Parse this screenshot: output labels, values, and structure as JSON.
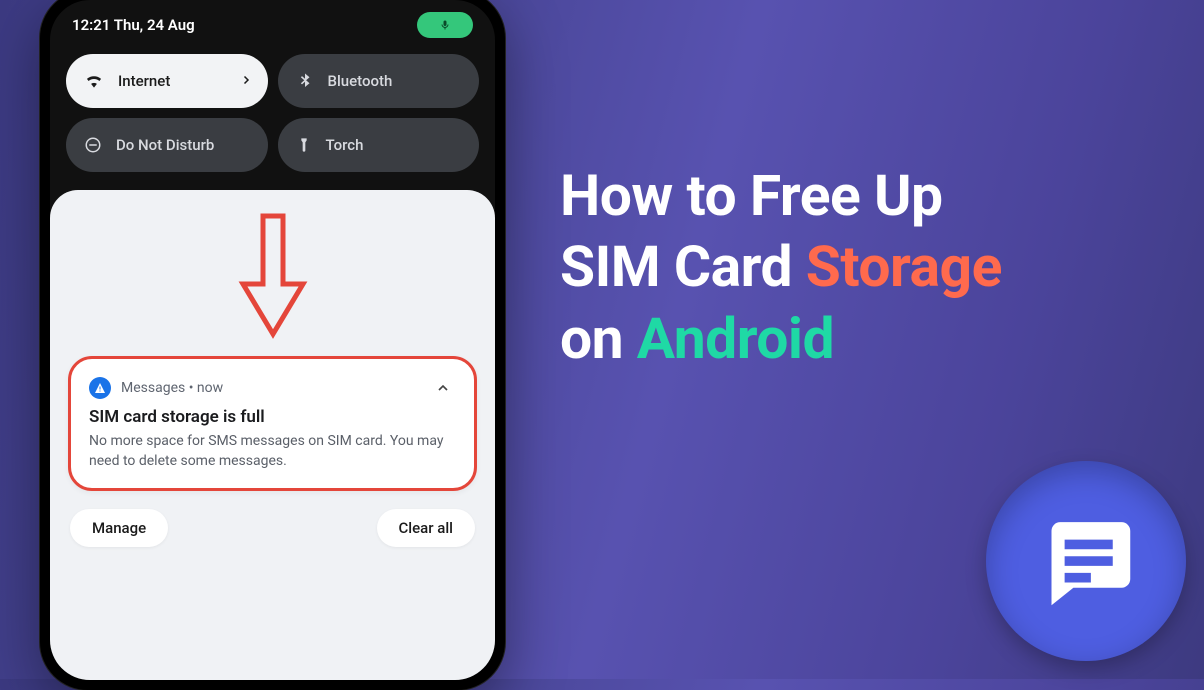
{
  "status": {
    "time_date": "12:21 Thu, 24 Aug"
  },
  "qs": {
    "internet": {
      "label": "Internet"
    },
    "bluetooth": {
      "label": "Bluetooth"
    },
    "dnd": {
      "label": "Do Not Disturb"
    },
    "torch": {
      "label": "Torch"
    }
  },
  "notification": {
    "app": "Messages",
    "sep": " • ",
    "when": "now",
    "title": "SIM card storage is full",
    "body": "No more space for SMS messages on SIM card. You may need to delete some messages."
  },
  "shade_actions": {
    "manage": "Manage",
    "clear": "Clear all"
  },
  "headline": {
    "l1": "How to Free Up",
    "l2a": "SIM Card ",
    "l2b": "Storage",
    "l3a": "on ",
    "l3b": "Android"
  }
}
